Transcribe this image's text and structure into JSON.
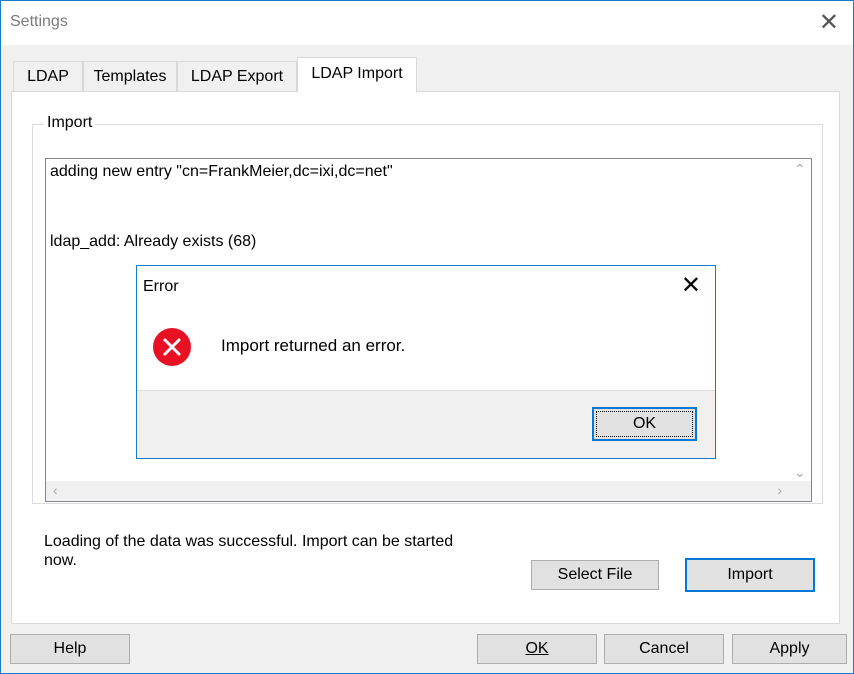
{
  "window": {
    "title": "Settings",
    "close_glyph": "✕"
  },
  "tabs": [
    {
      "label": "LDAP",
      "active": false
    },
    {
      "label": "Templates",
      "active": false
    },
    {
      "label": "LDAP Export",
      "active": false
    },
    {
      "label": "LDAP Import",
      "active": true
    }
  ],
  "import_group": {
    "legend": "Import",
    "log_lines": [
      "adding new entry \"cn=FrankMeier,dc=ixi,dc=net\"",
      "ldap_add: Already exists (68)"
    ]
  },
  "status": {
    "line1": "Loading of the data was successful. Import can be started",
    "line2": "now."
  },
  "import_buttons": {
    "select_file": "Select File",
    "import": "Import"
  },
  "footer": {
    "help": "Help",
    "ok": "OK",
    "cancel": "Cancel",
    "apply": "Apply"
  },
  "dialog": {
    "title": "Error",
    "close_glyph": "✕",
    "message": "Import returned an error.",
    "ok_label": "OK",
    "icon": "error-icon"
  },
  "colors": {
    "accent": "#0078d7",
    "error": "#e81123",
    "window_border": "#1979ca"
  }
}
